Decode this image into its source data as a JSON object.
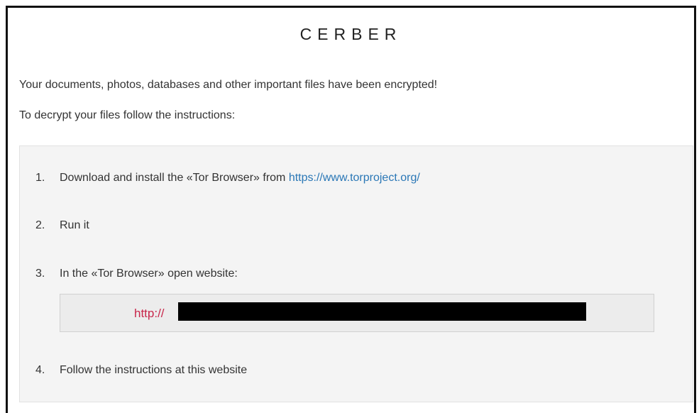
{
  "header": {
    "title": "CERBER"
  },
  "message": {
    "line1": "Your documents, photos, databases and other important files have been encrypted!",
    "line2": "To decrypt your files follow the instructions:"
  },
  "instructions": {
    "steps": [
      {
        "number": "1.",
        "text": "Download and install the «Tor Browser» from ",
        "link_text": "https://www.torproject.org/"
      },
      {
        "number": "2.",
        "text": "Run it"
      },
      {
        "number": "3.",
        "text": "In the «Tor Browser» open website:"
      },
      {
        "number": "4.",
        "text": "Follow the instructions at this website"
      }
    ],
    "website_url_prefix": "http://"
  },
  "colors": {
    "link": "#2a77b6",
    "url_prefix": "#c8264a",
    "panel_background": "#f4f4f4",
    "redaction": "#000000"
  }
}
